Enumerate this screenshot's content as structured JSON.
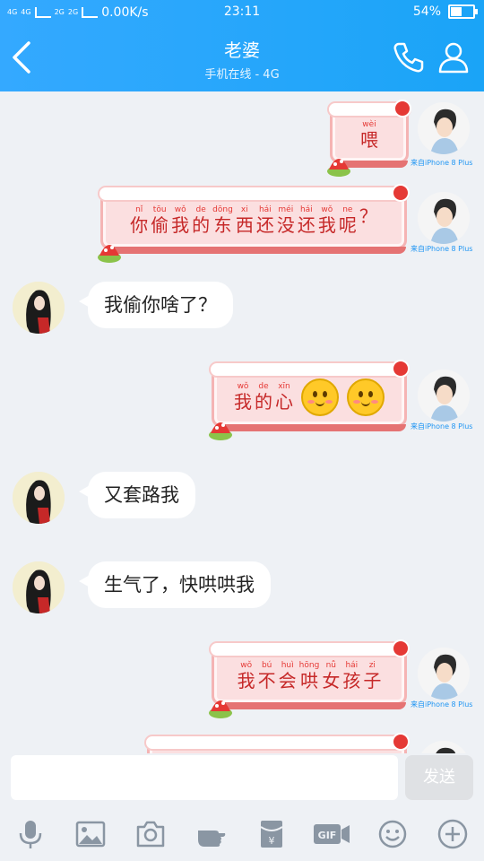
{
  "status_bar": {
    "network1": "4G",
    "network2": "4G",
    "network3": "2G",
    "network4": "2G",
    "speed": "0.00K/s",
    "time": "23:11",
    "battery": "54%",
    "battery_level": 0.54
  },
  "header": {
    "title": "老婆",
    "subtitle": "手机在线 - 4G",
    "icons": [
      "back-icon",
      "phone-icon",
      "profile-icon"
    ]
  },
  "device_label": "来自iPhone 8 Plus",
  "messages": [
    {
      "from": "me",
      "type": "sticker",
      "chars": [
        {
          "py": "wèi",
          "hz": "喂"
        }
      ]
    },
    {
      "from": "me",
      "type": "sticker",
      "chars": [
        {
          "py": "nǐ",
          "hz": "你"
        },
        {
          "py": "tōu",
          "hz": "偷"
        },
        {
          "py": "wǒ",
          "hz": "我"
        },
        {
          "py": "de",
          "hz": "的"
        },
        {
          "py": "dōng",
          "hz": "东"
        },
        {
          "py": "xi",
          "hz": "西"
        },
        {
          "py": "hái",
          "hz": "还"
        },
        {
          "py": "méi",
          "hz": "没"
        },
        {
          "py": "hái",
          "hz": "还"
        },
        {
          "py": "wǒ",
          "hz": "我"
        },
        {
          "py": "ne",
          "hz": "呢"
        },
        {
          "py": "",
          "hz": "？"
        }
      ]
    },
    {
      "from": "her",
      "type": "text",
      "text": "我偷你啥了？"
    },
    {
      "from": "me",
      "type": "sticker",
      "chars": [
        {
          "py": "wǒ",
          "hz": "我"
        },
        {
          "py": "de",
          "hz": "的"
        },
        {
          "py": "xīn",
          "hz": "心"
        }
      ],
      "emojis": 2
    },
    {
      "from": "her",
      "type": "text",
      "text": "又套路我"
    },
    {
      "from": "her",
      "type": "text",
      "text": "生气了，快哄哄我"
    },
    {
      "from": "me",
      "type": "sticker",
      "chars": [
        {
          "py": "wǒ",
          "hz": "我"
        },
        {
          "py": "bú",
          "hz": "不"
        },
        {
          "py": "huì",
          "hz": "会"
        },
        {
          "py": "hōng",
          "hz": "哄"
        },
        {
          "py": "nǚ",
          "hz": "女"
        },
        {
          "py": "hái",
          "hz": "孩"
        },
        {
          "py": "zi",
          "hz": "子"
        }
      ]
    }
  ],
  "input": {
    "value": "",
    "send_label": "发送"
  },
  "toolbar": {
    "items": [
      "mic-icon",
      "image-icon",
      "camera-icon",
      "hand-icon",
      "red-packet-icon",
      "gif-icon",
      "emoji-icon",
      "plus-icon"
    ],
    "gif_label": "GIF"
  }
}
